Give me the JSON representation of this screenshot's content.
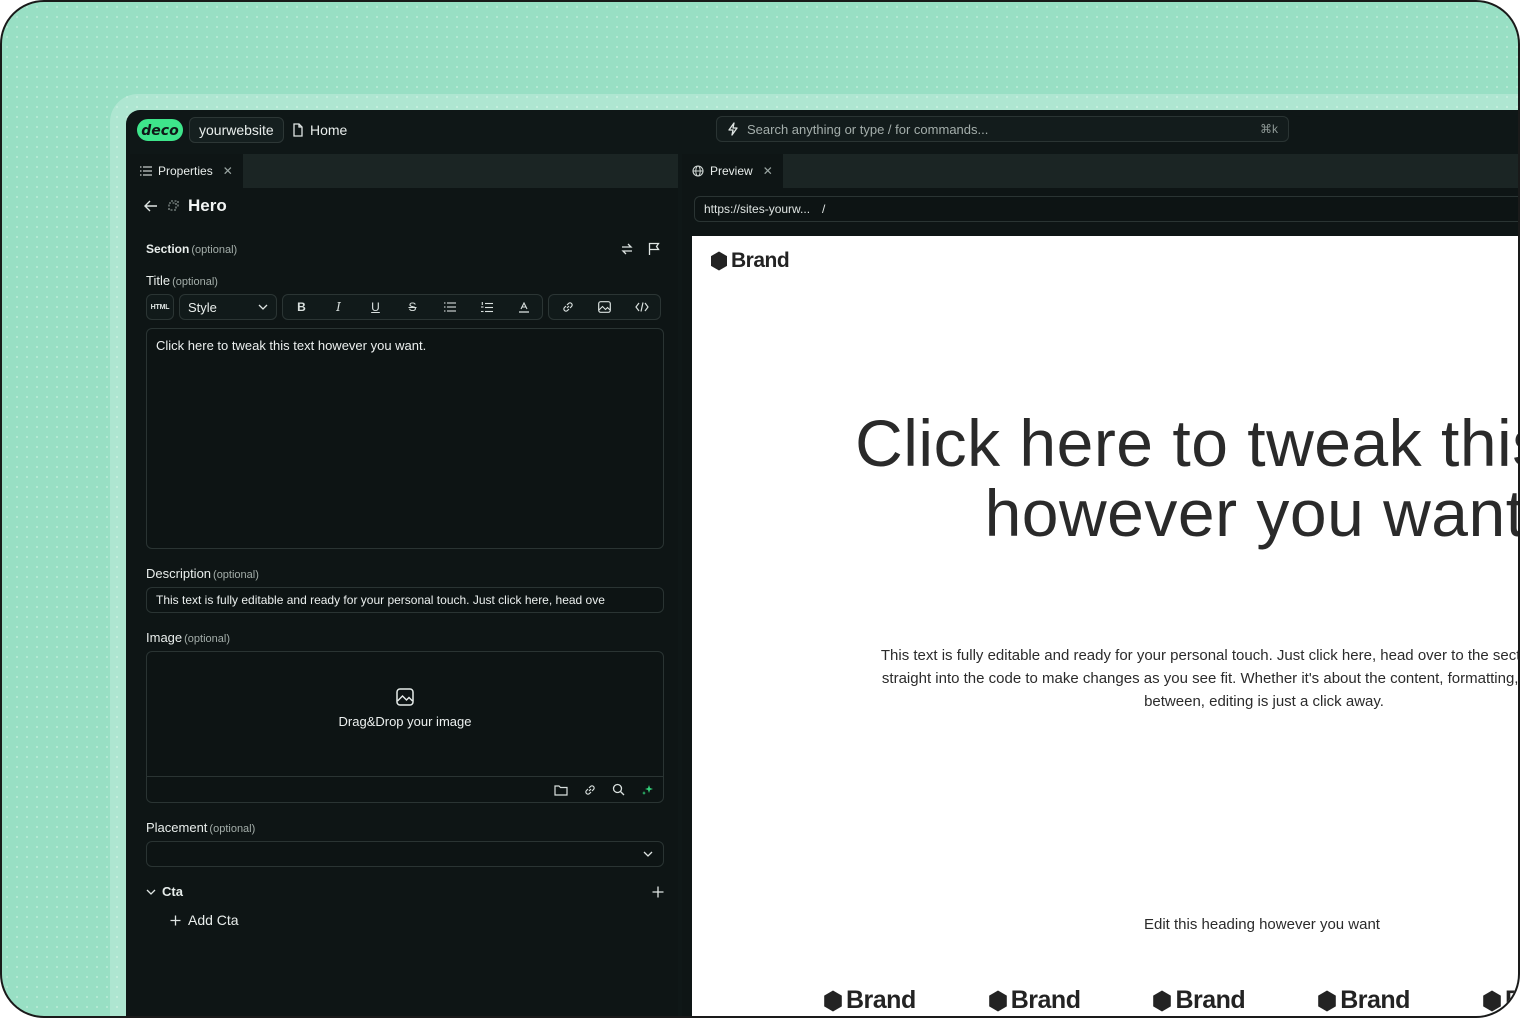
{
  "topbar": {
    "logo_text": "deco",
    "site_name": "yourwebsite",
    "page_name": "Home",
    "search_placeholder": "Search anything or type / for commands...",
    "search_shortcut": "⌘k"
  },
  "left_panel": {
    "tab_label": "Properties",
    "section_title": "Hero",
    "optional_label": "(optional)",
    "section_label": "Section",
    "title_label": "Title",
    "toolbar": {
      "html_badge": "HTML",
      "style_label": "Style",
      "bold": "B",
      "italic": "I",
      "underline": "U",
      "strike": "S"
    },
    "title_value": "Click here to tweak this text however you want.",
    "description_label": "Description",
    "description_value": "This text is fully editable and ready for your personal touch. Just click here, head ove",
    "image_label": "Image",
    "image_drop_text": "Drag&Drop your image",
    "placement_label": "Placement",
    "cta_label": "Cta",
    "add_cta_label": "Add Cta"
  },
  "right_panel": {
    "tab_label": "Preview",
    "url_text": "https://sites-yourw...",
    "url_path": "/",
    "canvas": {
      "brand_name": "Brand",
      "heading": "Click here to tweak this text however you want.",
      "description": "This text is fully editable and ready for your personal touch. Just click here, head over to the section window, or dive straight into the code to make changes as you see fit. Whether it's about the content, formatting, font, or anything in between, editing is just a click away.",
      "sub_heading": "Edit this heading however you want",
      "logos": [
        "Brand",
        "Brand",
        "Brand",
        "Brand",
        "Brand"
      ]
    }
  },
  "colors": {
    "outer_background": "#98dfc4",
    "app_background": "#0f1717",
    "logo_green": "#3ee58b",
    "accent_sparkle": "#33d17a"
  }
}
